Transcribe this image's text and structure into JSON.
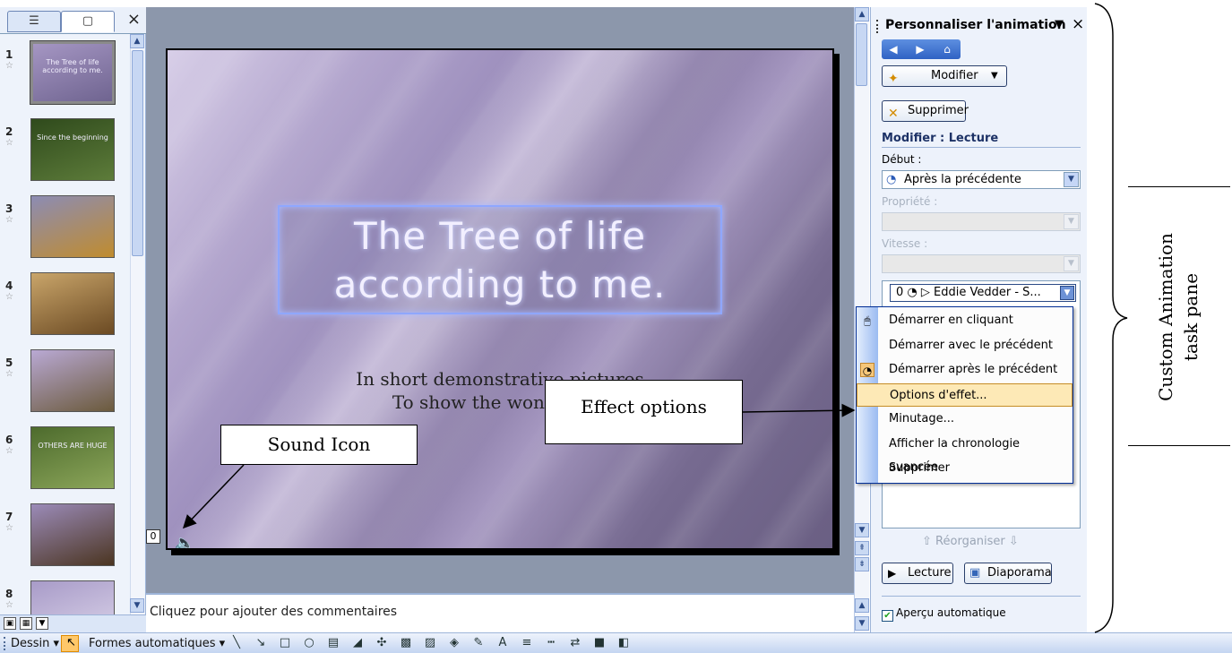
{
  "outline_pane": {
    "tabs": [
      {
        "name": "outline",
        "icon": "outline-tab-icon"
      },
      {
        "name": "slides",
        "icon": "slides-tab-icon",
        "selected": true
      }
    ],
    "close_glyph": "×",
    "thumbnails": [
      {
        "number": "1",
        "caption": "The Tree of life according to me.",
        "selected": true,
        "colors": [
          "#a596c3",
          "#6f6490"
        ]
      },
      {
        "number": "2",
        "caption": "Since the beginning",
        "colors": [
          "#2f4a1c",
          "#5d7c3a"
        ]
      },
      {
        "number": "3",
        "caption": "",
        "colors": [
          "#8c8cb4",
          "#c08c2e"
        ]
      },
      {
        "number": "4",
        "caption": "",
        "colors": [
          "#c9a56a",
          "#6b4a23"
        ]
      },
      {
        "number": "5",
        "caption": "",
        "colors": [
          "#b9a9d4",
          "#6b5a3c"
        ]
      },
      {
        "number": "6",
        "caption": "OTHERS ARE HUGE",
        "colors": [
          "#4d6b2d",
          "#8ca65a"
        ]
      },
      {
        "number": "7",
        "caption": "",
        "colors": [
          "#9b8bb8",
          "#4b3521"
        ]
      },
      {
        "number": "8",
        "caption": "",
        "colors": [
          "#a89bc8",
          "#dcd5ea"
        ]
      }
    ]
  },
  "slide": {
    "title_lines": [
      "The Tree of life",
      "according to me."
    ],
    "subtitle_lines": [
      "In short demonstrative pictures",
      "To show the wonders of"
    ],
    "sound_marker": "0"
  },
  "notes": {
    "placeholder": "Cliquez pour ajouter des commentaires"
  },
  "drawing_toolbar": {
    "draw_menu": "Dessin ▾",
    "autoshapes_menu": "Formes automatiques ▾",
    "tools": [
      "line-tool-icon",
      "arrow-tool-icon",
      "rectangle-tool-icon",
      "oval-tool-icon",
      "textbox-tool-icon",
      "wordart-tool-icon",
      "diagram-tool-icon",
      "clipart-tool-icon",
      "picture-tool-icon",
      "fill-color-icon",
      "line-color-icon",
      "font-color-icon",
      "line-style-icon",
      "dash-style-icon",
      "arrow-style-icon",
      "shadow-icon",
      "3d-icon"
    ]
  },
  "task_pane": {
    "title": "Personnaliser l'animation",
    "menu_glyph": "▼",
    "close_glyph": "×",
    "modify_button": "Modifier",
    "remove_button": "Supprimer",
    "modify_heading": "Modifier : Lecture",
    "start_label": "Début :",
    "start_value": "Après la précédente",
    "property_label": "Propriété :",
    "speed_label": "Vitesse :",
    "list_item": "0 ◔   ▷  Eddie Vedder - S...",
    "reorder_label": "Réorganiser",
    "play_button": "Lecture",
    "slideshow_button": "Diaporama",
    "autopreview_label": "Aperçu automatique",
    "autopreview_checked": true
  },
  "context_menu": {
    "items": [
      {
        "label": "Démarrer en cliquant",
        "icon": "mouse-click-icon"
      },
      {
        "label": "Démarrer avec le précédent",
        "icon": ""
      },
      {
        "label": "Démarrer après le précédent",
        "icon": "clock-icon",
        "checked": true
      },
      {
        "label": "Options d'effet...",
        "icon": "",
        "highlighted": true
      },
      {
        "label": "Minutage...",
        "icon": ""
      },
      {
        "label": "Afficher la chronologie avancée",
        "icon": ""
      },
      {
        "label": "Supprimer",
        "icon": ""
      }
    ]
  },
  "annotations": {
    "effect_options": "Effect options",
    "sound_icon": "Sound Icon",
    "side_label_lines": [
      "Custom Animation",
      "task pane"
    ]
  },
  "colors": {
    "highlight": "#fde9b6",
    "pane_bg": "#edf2fb",
    "slide_frame": "#000000",
    "nav_blue": "#2f62c4"
  }
}
